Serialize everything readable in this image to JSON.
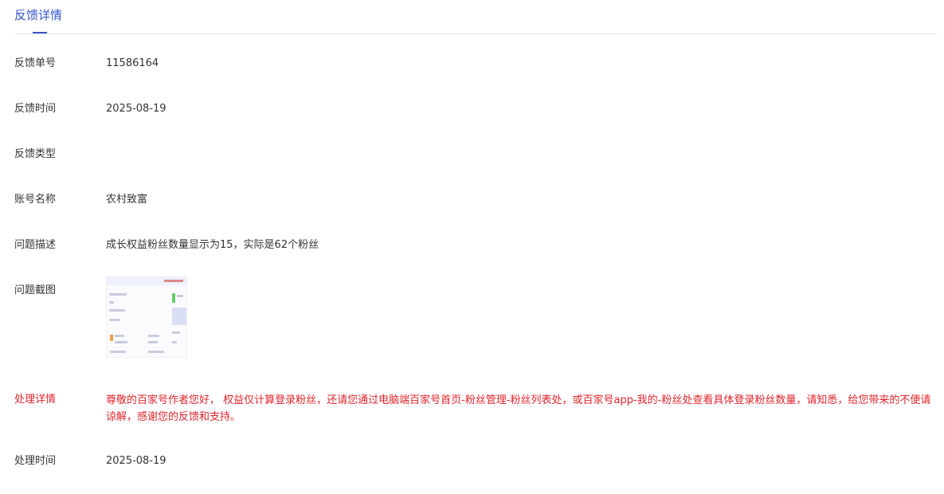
{
  "tab": {
    "label": "反馈详情"
  },
  "rows": [
    {
      "label": "反馈单号",
      "value": "11586164"
    },
    {
      "label": "反馈时间",
      "value": "2025-08-19"
    },
    {
      "label": "反馈类型",
      "value": ""
    },
    {
      "label": "账号名称",
      "value": "农村致富"
    },
    {
      "label": "问题描述",
      "value": "成长权益粉丝数量显示为15，实际是62个粉丝"
    },
    {
      "label": "问题截图"
    },
    {
      "label": "处理详情",
      "value": "尊敬的百家号作者您好， 权益仅计算登录粉丝，还请您通过电脑端百家号首页-粉丝管理-粉丝列表处，或百家号app-我的-粉丝处查看具体登录粉丝数量，请知悉，给您带来的不便请谅解，感谢您的反馈和支持。"
    },
    {
      "label": "处理时间",
      "value": "2025-08-19"
    }
  ],
  "colors": {
    "accent": "#3355cc",
    "alert": "#e0242b"
  }
}
